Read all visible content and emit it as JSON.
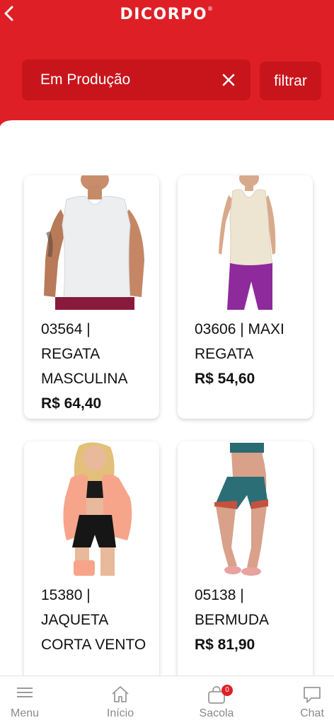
{
  "header": {
    "logo": "DICORPO",
    "logo_mark": "®",
    "back_icon": "chevron-left-icon",
    "search_value": "Em Produção",
    "clear_icon": "close-icon",
    "filter_label": "filtrar"
  },
  "colors": {
    "brand_red": "#df1f26",
    "search_bg": "#c8151c",
    "badge": "#df1f26"
  },
  "products": [
    {
      "title": "03564 | REGATA MASCULINA",
      "price": "R$ 64,40",
      "image": "man-white-tank-top"
    },
    {
      "title": "03606 | MAXI REGATA",
      "price": "R$ 54,60",
      "image": "woman-beige-tank-purple-leggings"
    },
    {
      "title": "15380 | JAQUETA CORTA VENTO",
      "price": "",
      "image": "woman-coral-windbreaker-jacket"
    },
    {
      "title": "05138 | BERMUDA",
      "price": "R$ 81,90",
      "image": "woman-teal-bermuda-shorts"
    }
  ],
  "bottom_nav": [
    {
      "label": "Menu",
      "icon": "hamburger-menu-icon"
    },
    {
      "label": "Início",
      "icon": "home-icon"
    },
    {
      "label": "Sacola",
      "icon": "shopping-bag-icon",
      "badge": "0"
    },
    {
      "label": "Chat",
      "icon": "chat-bubble-icon"
    }
  ]
}
